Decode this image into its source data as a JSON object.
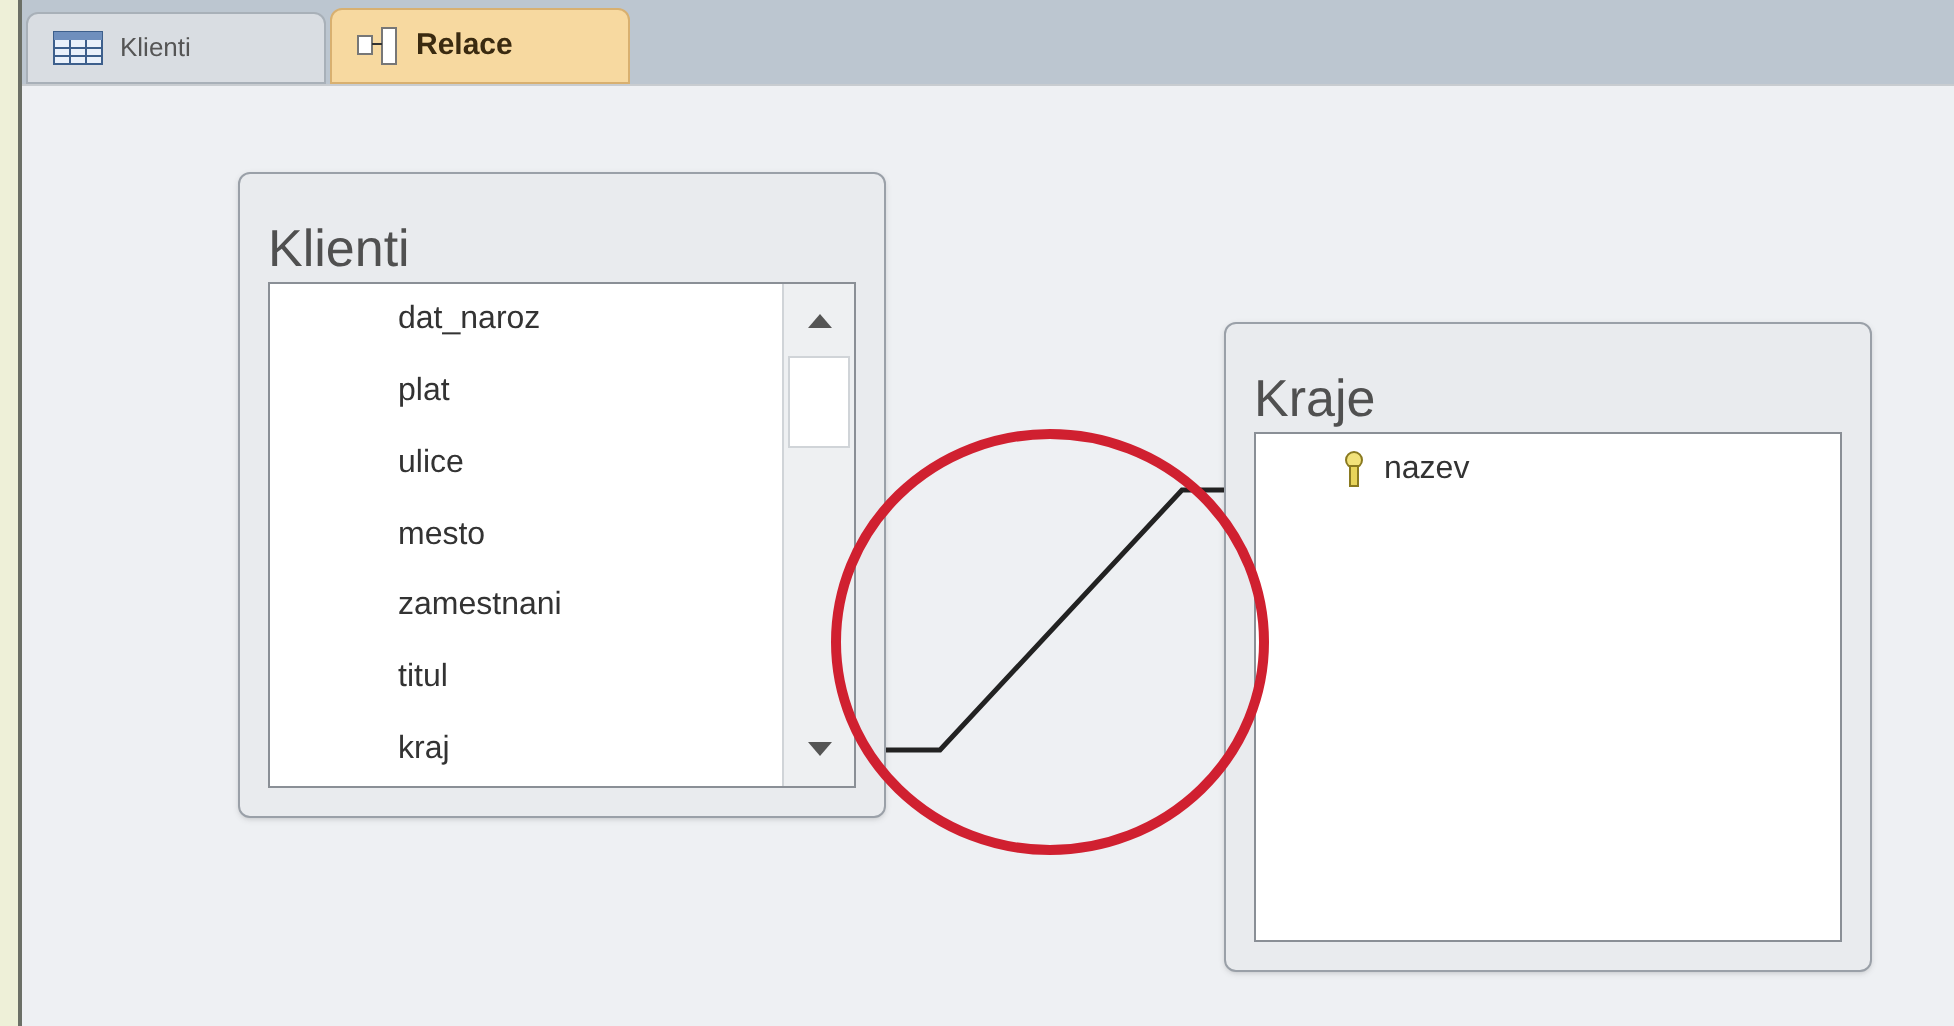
{
  "tabs": [
    {
      "label": "Klienti",
      "kind": "table",
      "selected": false
    },
    {
      "label": "Relace",
      "kind": "relations",
      "selected": true
    }
  ],
  "tables": [
    {
      "title": "Klienti",
      "scrollbar": true,
      "fields": [
        {
          "name": "dat_naroz",
          "key": false
        },
        {
          "name": "plat",
          "key": false
        },
        {
          "name": "ulice",
          "key": false
        },
        {
          "name": "mesto",
          "key": false
        },
        {
          "name": "zamestnani",
          "key": false
        },
        {
          "name": "titul",
          "key": false
        },
        {
          "name": "kraj",
          "key": false
        }
      ]
    },
    {
      "title": "Kraje",
      "scrollbar": false,
      "fields": [
        {
          "name": "nazev",
          "key": true
        }
      ]
    }
  ]
}
